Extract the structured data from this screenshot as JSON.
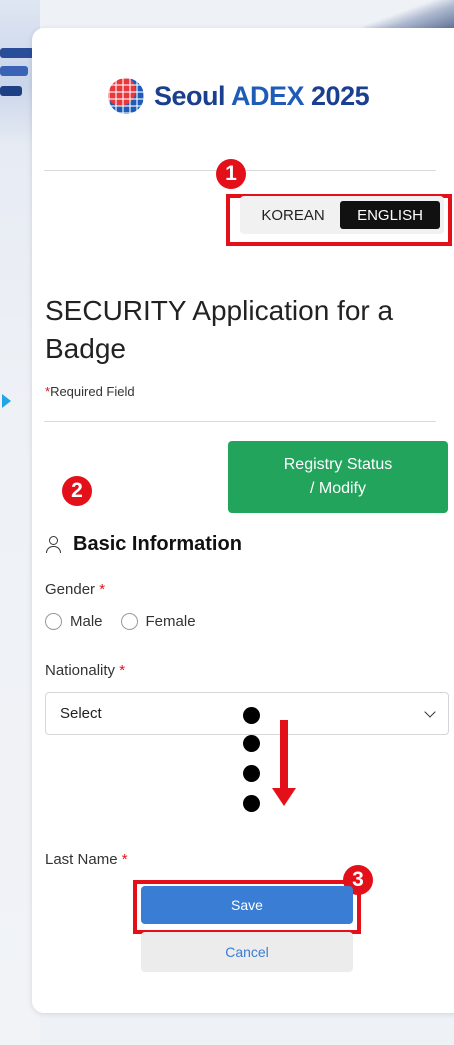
{
  "logo": {
    "part1": "Seoul ",
    "part2": "ADEX",
    "part3": " 2025"
  },
  "language": {
    "korean": "KOREAN",
    "english": "ENGLISH",
    "selected": "ENGLISH"
  },
  "annotations": {
    "n1": "1",
    "n2": "2",
    "n3": "3"
  },
  "page": {
    "title": "SECURITY Application for a Badge",
    "required_star": "*",
    "required_note": "Required Field"
  },
  "registry_button": {
    "line1": "Registry Status",
    "line2": "/ Modify"
  },
  "section": {
    "title": "Basic Information",
    "icon": "user-icon"
  },
  "fields": {
    "gender": {
      "label": "Gender",
      "star": "*",
      "options": [
        "Male",
        "Female"
      ]
    },
    "nationality": {
      "label": "Nationality",
      "star": "*",
      "selected": "Select"
    },
    "last_name": {
      "label": "Last Name",
      "star": "*"
    }
  },
  "actions": {
    "save": "Save",
    "cancel": "Cancel"
  },
  "colors": {
    "annotation_red": "#e3101a",
    "registry_green": "#22a45d",
    "save_blue": "#3a7dd4",
    "english_active": "#111111",
    "brand_blue": "#1b3f8f"
  }
}
